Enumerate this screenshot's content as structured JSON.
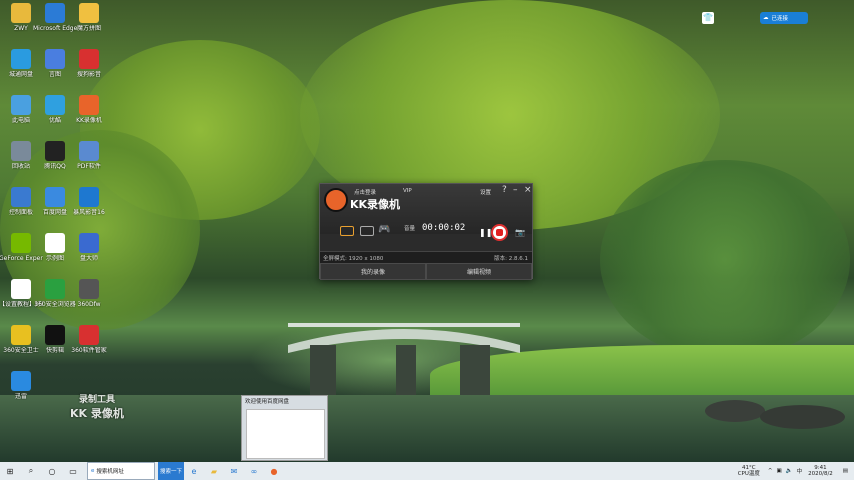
{
  "desktop": {
    "icons": [
      {
        "label": "ZWY",
        "icon": "folder-icon",
        "color": "#e8b93c"
      },
      {
        "label": "Microsoft Edge",
        "icon": "edge-icon",
        "color": "#2b7bd6"
      },
      {
        "label": "魔方拼图",
        "icon": "app-icon",
        "color": "#f0c040"
      },
      {
        "label": "城通网盘",
        "icon": "cloud-icon",
        "color": "#2a9be0"
      },
      {
        "label": "言图",
        "icon": "app-icon",
        "color": "#4a7ee0"
      },
      {
        "label": "搜狗影音",
        "icon": "media-icon",
        "color": "#d83030"
      },
      {
        "label": "此电脑",
        "icon": "computer-icon",
        "color": "#4aa0e0"
      },
      {
        "label": "优酷",
        "icon": "youku-icon",
        "color": "#2fa0e0"
      },
      {
        "label": "KK录像机",
        "icon": "kk-icon",
        "color": "#e8642a"
      },
      {
        "label": "回收站",
        "icon": "recycle-bin-icon",
        "color": "#7a8a9a"
      },
      {
        "label": "腾讯QQ",
        "icon": "qq-icon",
        "color": "#222222"
      },
      {
        "label": "PDF软件",
        "icon": "pdf-icon",
        "color": "#5a8ad0"
      },
      {
        "label": "控制面板",
        "icon": "control-panel-icon",
        "color": "#3a7ad0"
      },
      {
        "label": "百度网盘",
        "icon": "baidu-netdisk-icon",
        "color": "#3a8ae0"
      },
      {
        "label": "暴风影音16",
        "icon": "app-icon",
        "color": "#1e78d0"
      },
      {
        "label": "GeForce Experience",
        "icon": "nvidia-icon",
        "color": "#76b900"
      },
      {
        "label": "示例图",
        "icon": "file-icon",
        "color": "#ffffff"
      },
      {
        "label": "盘大师",
        "icon": "app-icon",
        "color": "#3a6ad0"
      },
      {
        "label": "【设置教程】好录影",
        "icon": "file-icon",
        "color": "#ffffff"
      },
      {
        "label": "360安全浏览器",
        "icon": "360-browser-icon",
        "color": "#2aa040"
      },
      {
        "label": "360Dfw",
        "icon": "app-icon",
        "color": "#555555"
      },
      {
        "label": "360安全卫士",
        "icon": "360-guard-icon",
        "color": "#e8c020"
      },
      {
        "label": "快剪辑",
        "icon": "app-icon",
        "color": "#111111"
      },
      {
        "label": "360软件管家",
        "icon": "app-icon",
        "color": "#d83030"
      },
      {
        "label": "迅雷",
        "icon": "app-icon",
        "color": "#2a8ae0"
      }
    ]
  },
  "kk_window": {
    "click_login": "点击登录",
    "vip": "VIP",
    "settings": "设置",
    "help": "?",
    "minimize": "–",
    "close": "×",
    "title": "KK录像机",
    "volume_label": "音量",
    "timer": "00:00:02",
    "status_left": "全屏模式: 1920 x 1080",
    "status_right": "版本: 2.8.6.1",
    "btn_records": "我的录像",
    "btn_edit": "编辑视频"
  },
  "watermark": {
    "line1": "录制工具",
    "line2": "KK 录像机"
  },
  "popup": {
    "title": "欢迎使用百度网盘"
  },
  "taskbar": {
    "search_text": "搜索机网址",
    "active_app": "搜索一下",
    "temperature": "41°C",
    "cpu_label": "CPU温度",
    "time": "9:41",
    "date": "2020/8/2"
  },
  "top_right_badge": "已连接"
}
